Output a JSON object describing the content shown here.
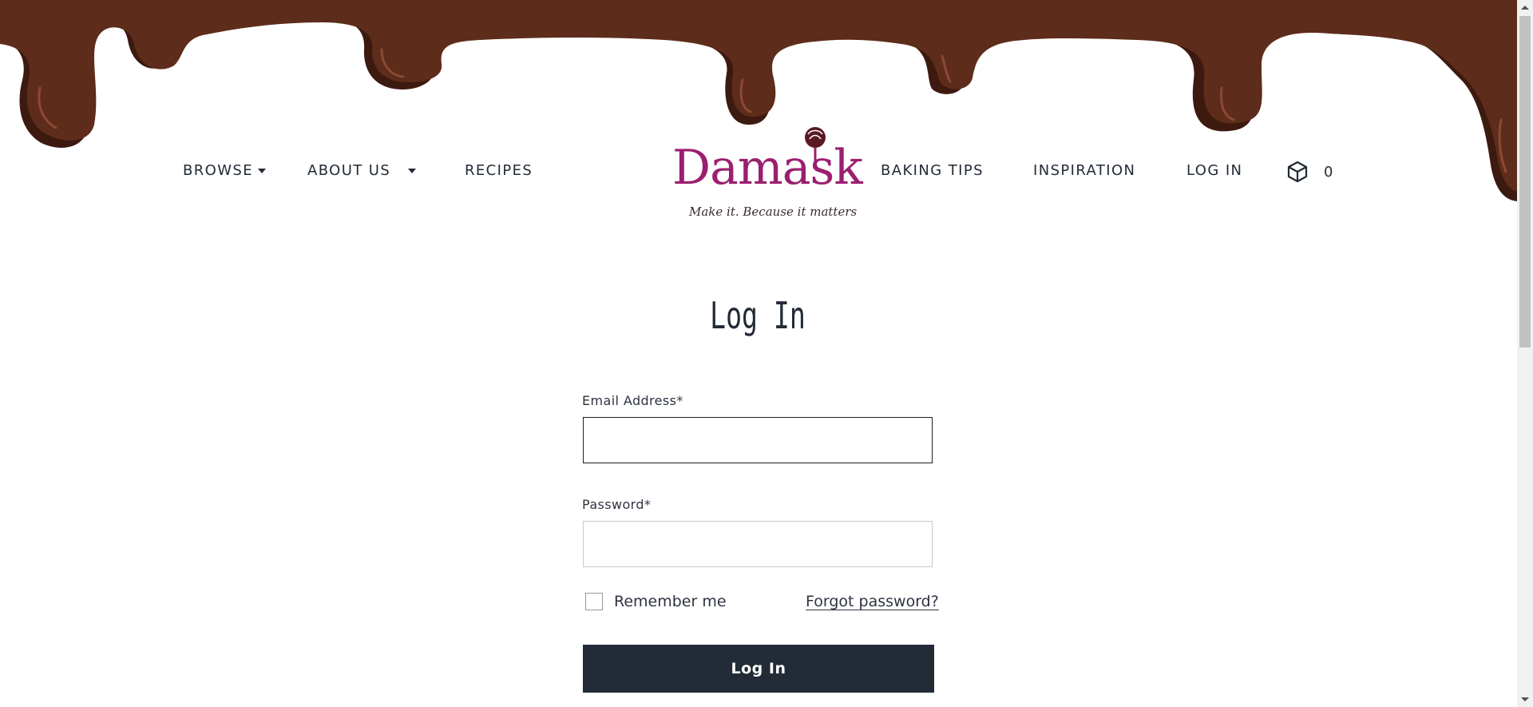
{
  "nav": {
    "browse": "BROWSE",
    "about": "ABOUT US",
    "recipes": "RECIPES",
    "baking_tips": "BAKING TIPS",
    "inspiration": "INSPIRATION",
    "login": "LOG IN",
    "cart_count": "0"
  },
  "logo": {
    "name": "Damask",
    "tagline": "Make it. Because it matters"
  },
  "form": {
    "title": "Log In",
    "email_label": "Email Address*",
    "email_value": "",
    "password_label": "Password*",
    "password_value": "",
    "remember_label": "Remember me",
    "forgot_label": "Forgot password?",
    "submit_label": "Log In"
  },
  "colors": {
    "chocolate": "#5e2c1a",
    "chocolate_dark": "#3d1a10",
    "brand": "#9b1f6f",
    "button": "#222b36"
  },
  "icons": {
    "cart": "box-icon",
    "caret": "caret-down-icon"
  }
}
